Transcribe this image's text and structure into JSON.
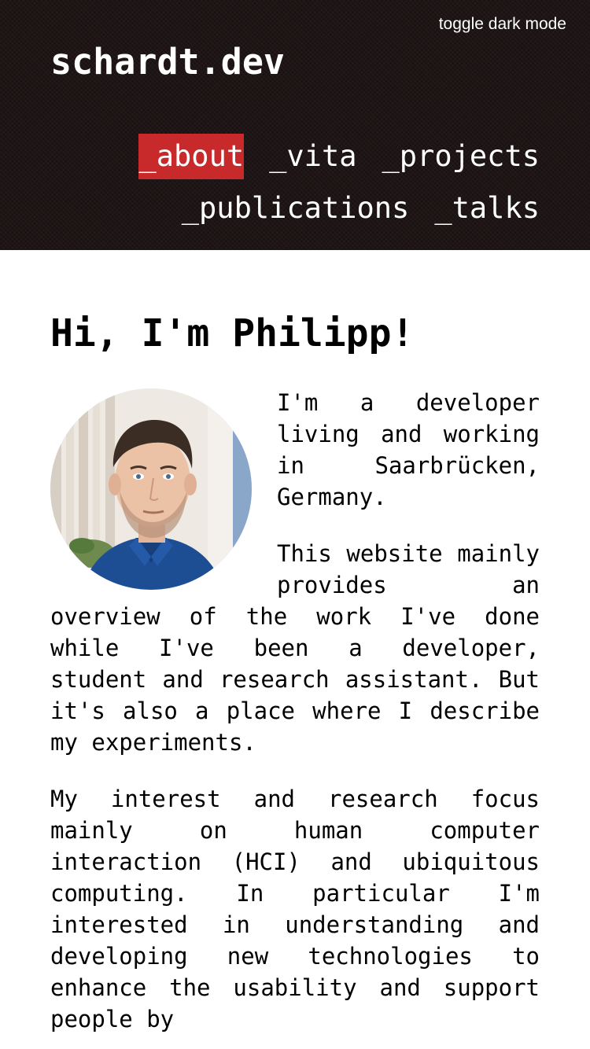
{
  "header": {
    "toggle_label": "toggle dark mode",
    "logo": "schardt.dev",
    "background_color": "#1a1011",
    "accent_color": "#c8292b",
    "nav": [
      {
        "label": "_about",
        "active": true
      },
      {
        "label": "_vita",
        "active": false
      },
      {
        "label": "_projects",
        "active": false
      },
      {
        "label": "_publications",
        "active": false
      },
      {
        "label": "_talks",
        "active": false
      }
    ]
  },
  "main": {
    "title": "Hi, I'm Philipp!",
    "paragraphs": [
      "I'm a developer living and working in Saarbrücken, Germany.",
      "This website mainly provides an overview of the work I've done while I've been a developer, student and research assistant. But it's also a place where I describe my experiments.",
      "My interest and research focus mainly on human computer interaction (HCI) and ubiquitous computing. In particular I'm interested in understanding and developing new technologies to enhance the usability and support people by"
    ]
  }
}
